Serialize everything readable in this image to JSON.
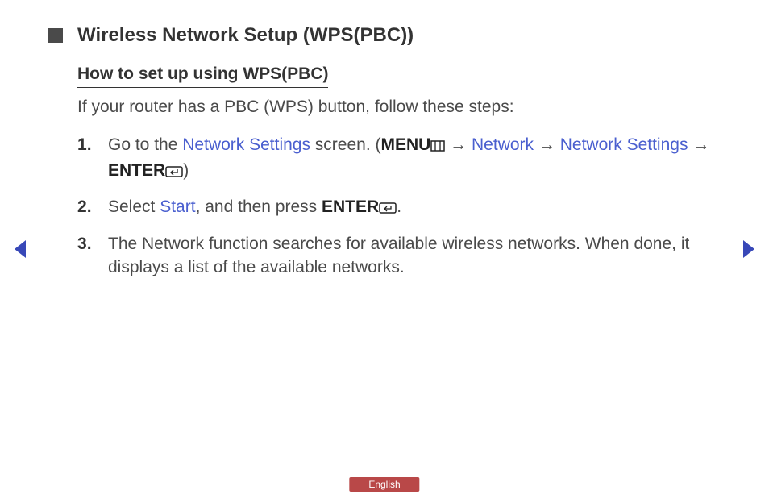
{
  "title": "Wireless Network Setup (WPS(PBC))",
  "subtitle": "How to set up using WPS(PBC)",
  "intro": "If your router has a PBC (WPS) button, follow these steps:",
  "steps": {
    "s1": {
      "t1": "Go to the ",
      "link1": "Network Settings",
      "t2": " screen. (",
      "menu": "MENU",
      "arrow1": " → ",
      "link2": "Network",
      "arrow2": " → ",
      "link3": "Network Settings",
      "arrow3": " → ",
      "enter": "ENTER",
      "t3": ")"
    },
    "s2": {
      "t1": "Select ",
      "link1": "Start",
      "t2": ", and then press ",
      "enter": "ENTER",
      "t3": "."
    },
    "s3": {
      "t1": "The Network function searches for available wireless networks. When done, it displays a list of the available networks."
    }
  },
  "language": "English"
}
